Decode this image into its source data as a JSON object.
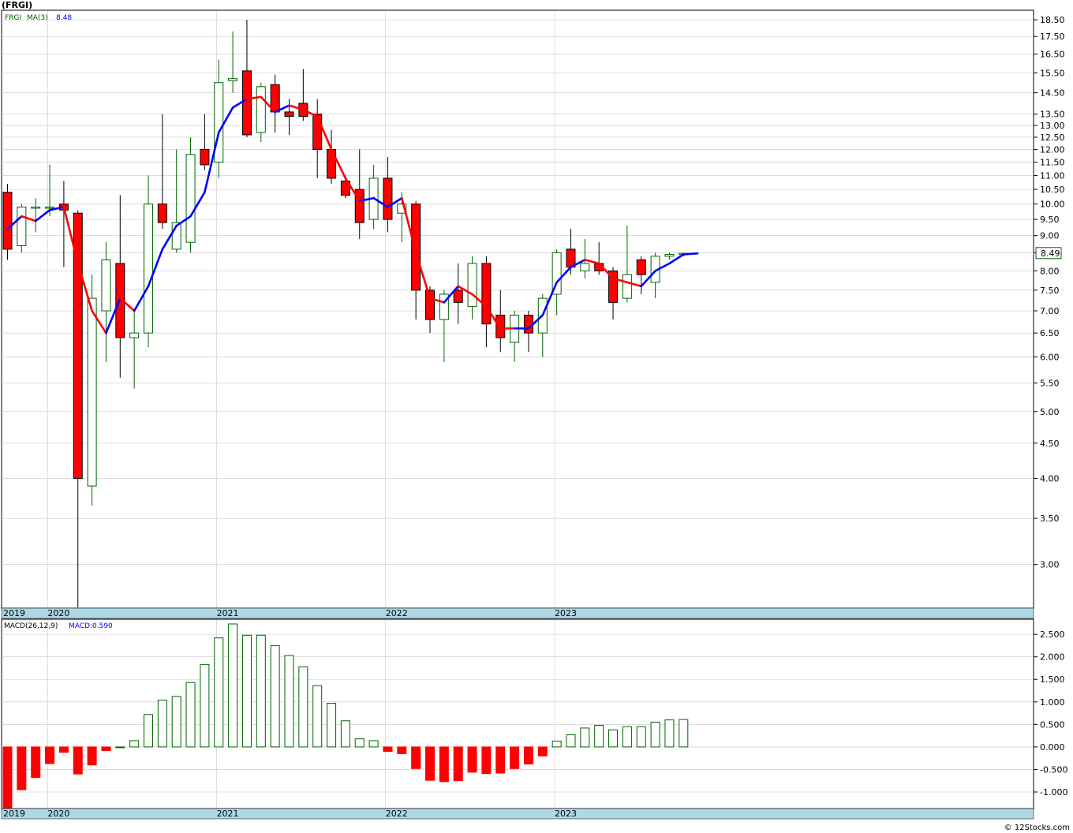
{
  "ticker": "(FRGI)",
  "legend": {
    "symbol": "FRGI",
    "ma_label": "MA(3)",
    "ma_value": "8.48"
  },
  "last_price": "8.49",
  "macd_legend": {
    "params": "MACD(26,12,9)",
    "value": "MACD:0.590"
  },
  "watermark": "© 12Stocks.com",
  "x_axis": {
    "labels": [
      {
        "text": "2019",
        "index": -0.7
      },
      {
        "text": "2020",
        "index": 2.85
      },
      {
        "text": "2021",
        "index": 14.85
      },
      {
        "text": "2022",
        "index": 26.85
      },
      {
        "text": "2023",
        "index": 38.85
      }
    ]
  },
  "colors": {
    "up_fill": "#ffffff",
    "up_stroke": "#006400",
    "down_fill": "#ff0000",
    "down_stroke": "#000000",
    "ma_up": "#0000ff",
    "ma_down": "#ff0000",
    "axis_bar": "#add8e6",
    "legend_text": "#006400",
    "ma_text": "#0000ff"
  },
  "chart_data": [
    {
      "type": "candlestick",
      "title": "(FRGI)",
      "period": "monthly",
      "y_scale": "log",
      "ylim": [
        2.6,
        19.0
      ],
      "y_ticks": [
        3.0,
        3.5,
        4.0,
        4.5,
        5.0,
        5.5,
        6.0,
        6.5,
        7.0,
        7.5,
        8.0,
        8.5,
        9.0,
        9.5,
        10.0,
        10.5,
        11.0,
        11.5,
        12.0,
        12.5,
        13.0,
        13.5,
        14.5,
        15.5,
        16.5,
        17.5,
        18.5
      ],
      "candles": [
        {
          "o": 10.4,
          "h": 10.7,
          "l": 8.3,
          "c": 8.6
        },
        {
          "o": 8.7,
          "h": 10.0,
          "l": 8.5,
          "c": 9.9
        },
        {
          "o": 9.9,
          "h": 10.2,
          "l": 9.1,
          "c": 9.9
        },
        {
          "o": 9.9,
          "h": 11.4,
          "l": 9.6,
          "c": 9.9
        },
        {
          "o": 10.0,
          "h": 10.8,
          "l": 8.1,
          "c": 9.8
        },
        {
          "o": 9.7,
          "h": 9.8,
          "l": 2.6,
          "c": 4.0
        },
        {
          "o": 3.9,
          "h": 7.9,
          "l": 3.65,
          "c": 7.3
        },
        {
          "o": 7.0,
          "h": 8.8,
          "l": 5.9,
          "c": 8.3
        },
        {
          "o": 8.2,
          "h": 10.3,
          "l": 5.6,
          "c": 6.4
        },
        {
          "o": 6.4,
          "h": 7.0,
          "l": 5.4,
          "c": 6.5
        },
        {
          "o": 6.5,
          "h": 11.0,
          "l": 6.2,
          "c": 10.0
        },
        {
          "o": 10.0,
          "h": 13.5,
          "l": 9.2,
          "c": 9.4
        },
        {
          "o": 8.6,
          "h": 12.0,
          "l": 8.5,
          "c": 9.4
        },
        {
          "o": 8.8,
          "h": 12.5,
          "l": 8.5,
          "c": 11.8
        },
        {
          "o": 12.0,
          "h": 13.5,
          "l": 11.2,
          "c": 11.4
        },
        {
          "o": 11.5,
          "h": 16.2,
          "l": 10.9,
          "c": 15.0
        },
        {
          "o": 15.1,
          "h": 17.8,
          "l": 14.5,
          "c": 15.2
        },
        {
          "o": 15.6,
          "h": 18.5,
          "l": 12.5,
          "c": 12.6
        },
        {
          "o": 12.7,
          "h": 15.0,
          "l": 12.3,
          "c": 14.8
        },
        {
          "o": 14.9,
          "h": 15.4,
          "l": 12.7,
          "c": 13.6
        },
        {
          "o": 13.6,
          "h": 14.2,
          "l": 12.6,
          "c": 13.4
        },
        {
          "o": 14.0,
          "h": 15.7,
          "l": 13.2,
          "c": 13.4
        },
        {
          "o": 13.5,
          "h": 14.2,
          "l": 10.9,
          "c": 12.0
        },
        {
          "o": 12.0,
          "h": 12.8,
          "l": 10.7,
          "c": 10.9
        },
        {
          "o": 10.8,
          "h": 11.0,
          "l": 10.2,
          "c": 10.3
        },
        {
          "o": 10.5,
          "h": 12.0,
          "l": 8.9,
          "c": 9.4
        },
        {
          "o": 9.5,
          "h": 11.4,
          "l": 9.2,
          "c": 10.9
        },
        {
          "o": 10.9,
          "h": 11.7,
          "l": 9.1,
          "c": 9.5
        },
        {
          "o": 9.7,
          "h": 10.4,
          "l": 8.8,
          "c": 10.0
        },
        {
          "o": 10.0,
          "h": 10.1,
          "l": 6.8,
          "c": 7.5
        },
        {
          "o": 7.5,
          "h": 7.6,
          "l": 6.5,
          "c": 6.8
        },
        {
          "o": 6.8,
          "h": 7.5,
          "l": 5.9,
          "c": 7.4
        },
        {
          "o": 7.5,
          "h": 8.2,
          "l": 6.7,
          "c": 7.2
        },
        {
          "o": 7.1,
          "h": 8.4,
          "l": 6.8,
          "c": 8.2
        },
        {
          "o": 8.2,
          "h": 8.4,
          "l": 6.2,
          "c": 6.7
        },
        {
          "o": 6.9,
          "h": 7.5,
          "l": 6.1,
          "c": 6.4
        },
        {
          "o": 6.3,
          "h": 7.0,
          "l": 5.9,
          "c": 6.9
        },
        {
          "o": 6.9,
          "h": 7.0,
          "l": 6.1,
          "c": 6.5
        },
        {
          "o": 6.5,
          "h": 7.4,
          "l": 6.0,
          "c": 7.3
        },
        {
          "o": 7.4,
          "h": 8.6,
          "l": 6.9,
          "c": 8.5
        },
        {
          "o": 8.6,
          "h": 9.2,
          "l": 7.9,
          "c": 8.1
        },
        {
          "o": 8.0,
          "h": 8.9,
          "l": 7.8,
          "c": 8.2
        },
        {
          "o": 8.2,
          "h": 8.8,
          "l": 7.9,
          "c": 8.0
        },
        {
          "o": 8.0,
          "h": 8.1,
          "l": 6.8,
          "c": 7.2
        },
        {
          "o": 7.3,
          "h": 9.3,
          "l": 7.2,
          "c": 7.9
        },
        {
          "o": 8.3,
          "h": 8.4,
          "l": 7.4,
          "c": 7.9
        },
        {
          "o": 7.7,
          "h": 8.5,
          "l": 7.3,
          "c": 8.4
        },
        {
          "o": 8.4,
          "h": 8.5,
          "l": 8.3,
          "c": 8.45
        },
        {
          "o": 8.45,
          "h": 8.5,
          "l": 8.4,
          "c": 8.48
        }
      ],
      "ma3": [
        9.2,
        9.6,
        9.45,
        9.8,
        9.9,
        8.2,
        7.0,
        6.5,
        7.3,
        7.0,
        7.6,
        8.6,
        9.3,
        9.6,
        10.4,
        12.7,
        13.8,
        14.2,
        14.3,
        13.6,
        13.9,
        13.7,
        13.4,
        12.0,
        10.9,
        10.1,
        10.2,
        9.9,
        10.2,
        8.5,
        7.3,
        7.2,
        7.6,
        7.4,
        7.1,
        6.6,
        6.6,
        6.6,
        6.9,
        7.7,
        8.1,
        8.3,
        8.2,
        7.8,
        7.7,
        7.6,
        8.0,
        8.2,
        8.45,
        8.48
      ],
      "ma_color_segments": [
        "up",
        "down",
        "up",
        "up",
        "down",
        "down",
        "down",
        "up",
        "down",
        "up",
        "up",
        "up",
        "up",
        "up",
        "up",
        "up",
        "up",
        "down",
        "down",
        "up",
        "down",
        "down",
        "down",
        "down",
        "down",
        "up",
        "up",
        "up",
        "down",
        "down",
        "down",
        "up",
        "down",
        "down",
        "down",
        "down",
        "up",
        "up",
        "up",
        "up",
        "up",
        "down",
        "down",
        "down",
        "down",
        "up",
        "up",
        "up",
        "up"
      ]
    },
    {
      "type": "bar",
      "title": "MACD(26,12,9)",
      "ylim": [
        -1.35,
        2.8
      ],
      "y_ticks": [
        -1.0,
        -0.5,
        0.0,
        0.5,
        1.0,
        1.5,
        2.0,
        2.5
      ],
      "y_tick_labels": [
        "-1.000",
        "-0.500",
        "0.000",
        "0.500",
        "1.000",
        "1.500",
        "2.000",
        "2.500"
      ],
      "values": [
        -1.35,
        -0.95,
        -0.68,
        -0.37,
        -0.12,
        -0.6,
        -0.4,
        -0.08,
        0.0,
        0.14,
        0.72,
        1.04,
        1.12,
        1.43,
        1.83,
        2.42,
        2.73,
        2.48,
        2.48,
        2.25,
        2.03,
        1.78,
        1.36,
        0.97,
        0.58,
        0.18,
        0.14,
        -0.1,
        -0.15,
        -0.48,
        -0.74,
        -0.77,
        -0.75,
        -0.56,
        -0.59,
        -0.58,
        -0.48,
        -0.38,
        -0.2,
        0.13,
        0.27,
        0.42,
        0.48,
        0.38,
        0.45,
        0.45,
        0.55,
        0.6,
        0.61
      ]
    }
  ]
}
